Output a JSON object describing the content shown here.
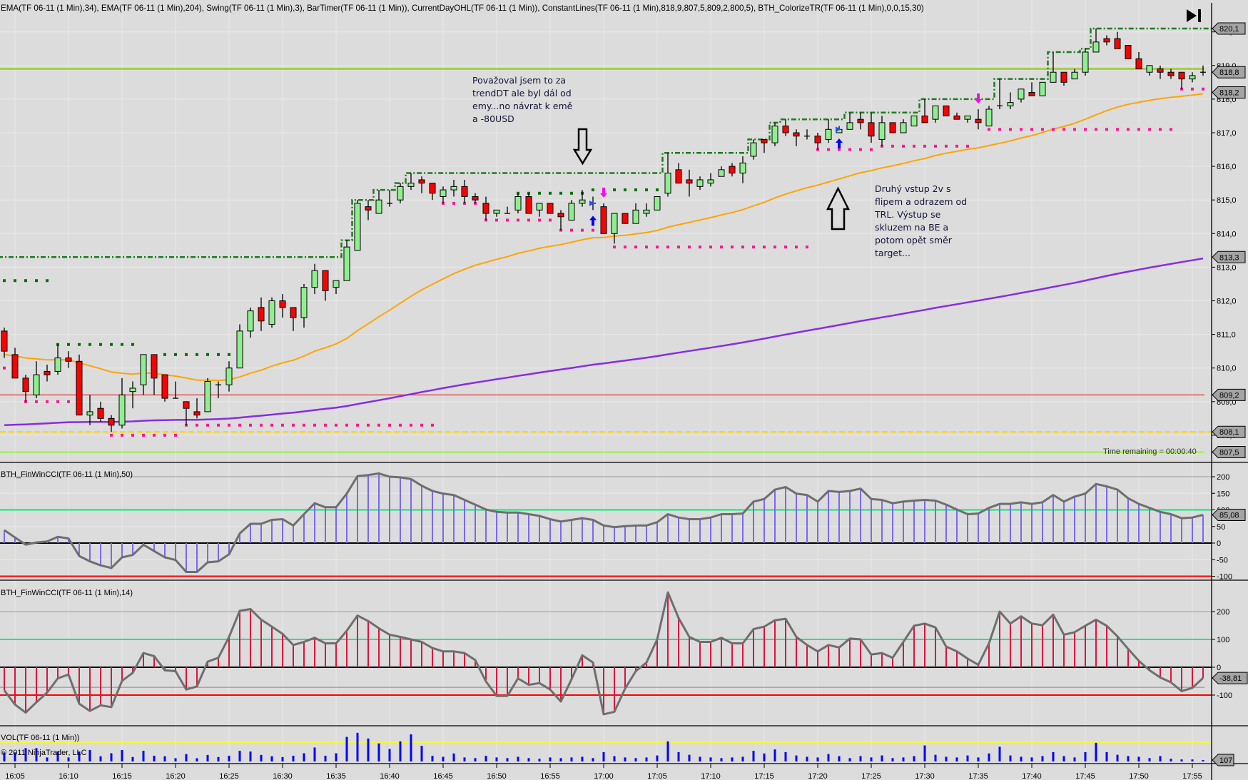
{
  "header": {
    "indicators": "EMA(TF 06-11 (1 Min),34), EMA(TF 06-11 (1 Min),204), Swing(TF 06-11 (1 Min),3), BarTimer(TF 06-11 (1 Min)), CurrentDayOHL(TF 06-11 (1 Min)), ConstantLines(TF 06-11 (1 Min),818,9,807,5,809,2,800,5), BTH_ColorizeTR(TF 06-11 (1 Min),0,0,15,30)",
    "scroll_end_icon": "skip-to-end-icon"
  },
  "panels": {
    "cci50_label": "BTH_FinWinCCI(TF 06-11 (1 Min),50)",
    "cci14_label": "BTH_FinWinCCI(TF 06-11 (1 Min),14)",
    "volume_label": "VOL(TF 06-11 (1 Min))",
    "copyright": "© 2011 NinjaTrader, LLC",
    "bar_timer": "Time remaining = 00:00:40"
  },
  "annotations": [
    {
      "text": "Považoval jsem to za\ntrendDT ale byl dál od\nemy...no návrat k emě\na -80USD",
      "arrow": "down"
    },
    {
      "text": "Druhý vstup 2v s\nflipem a odrazem od\nTRL. Výstup se\nskluzem na BE a\npotom opět směr\ntarget...",
      "arrow": "up"
    }
  ],
  "colors": {
    "background": "#dcdcdc",
    "up_candle": "#90ee90",
    "down_candle": "#ff0000",
    "ema34": "#ffa500",
    "ema204": "#8a2be2",
    "day_high": "#1e7b1e",
    "day_low": "#ffd700",
    "const_818_9": "#9acd32",
    "const_809_2": "#7cfc00",
    "const_807_5": "#e05050",
    "swing_high": "#007000",
    "swing_low": "#ff1493",
    "cci50_hist": "#7b68ee",
    "cci14_hist": "#dc143c",
    "cci_line": "#6e6e6e",
    "volume": "#0000ff"
  },
  "chart_data": {
    "type": "candlestick",
    "instrument": "TF 06-11",
    "interval": "1 Min",
    "first_bar_time": "16:04",
    "bar_interval_min": 1,
    "ohlc_fields": [
      "open",
      "high",
      "low",
      "close"
    ],
    "bars": [
      [
        811.1,
        811.2,
        810.3,
        810.5
      ],
      [
        810.4,
        810.6,
        809.7,
        809.7
      ],
      [
        809.7,
        809.8,
        809.0,
        809.3
      ],
      [
        809.2,
        810.2,
        809.1,
        809.8
      ],
      [
        809.9,
        810.1,
        809.6,
        809.8
      ],
      [
        809.9,
        810.7,
        809.8,
        810.3
      ],
      [
        810.3,
        810.5,
        810.0,
        810.2
      ],
      [
        810.2,
        810.4,
        808.6,
        808.6
      ],
      [
        808.6,
        809.2,
        808.3,
        808.7
      ],
      [
        808.8,
        809.0,
        808.4,
        808.5
      ],
      [
        808.5,
        808.6,
        808.1,
        808.3
      ],
      [
        808.3,
        809.7,
        808.2,
        809.2
      ],
      [
        809.3,
        809.6,
        808.8,
        809.4
      ],
      [
        809.5,
        810.4,
        809.2,
        810.4
      ],
      [
        810.4,
        810.4,
        809.2,
        809.7
      ],
      [
        809.8,
        809.8,
        809.0,
        809.1
      ],
      [
        809.1,
        809.6,
        809.1,
        809.1
      ],
      [
        809.0,
        809.0,
        808.3,
        808.8
      ],
      [
        808.7,
        809.1,
        808.5,
        808.6
      ],
      [
        808.7,
        809.7,
        808.7,
        809.6
      ],
      [
        809.5,
        809.6,
        809.1,
        809.5
      ],
      [
        809.5,
        810.2,
        809.3,
        810.0
      ],
      [
        810.0,
        811.3,
        810.0,
        811.1
      ],
      [
        811.1,
        811.8,
        810.9,
        811.7
      ],
      [
        811.8,
        812.1,
        811.1,
        811.4
      ],
      [
        811.3,
        812.1,
        811.2,
        812.0
      ],
      [
        812.0,
        812.2,
        811.5,
        811.8
      ],
      [
        811.8,
        811.8,
        811.1,
        811.5
      ],
      [
        811.5,
        812.5,
        811.2,
        812.4
      ],
      [
        812.4,
        813.1,
        812.2,
        812.9
      ],
      [
        812.9,
        812.9,
        812.0,
        812.3
      ],
      [
        812.4,
        812.6,
        812.2,
        812.6
      ],
      [
        812.6,
        813.8,
        812.6,
        813.6
      ],
      [
        813.5,
        815.0,
        813.5,
        814.9
      ],
      [
        814.8,
        815.0,
        814.4,
        814.7
      ],
      [
        814.6,
        815.3,
        814.6,
        815.0
      ],
      [
        814.9,
        815.3,
        814.8,
        814.9
      ],
      [
        815.0,
        815.5,
        814.9,
        815.4
      ],
      [
        815.4,
        815.8,
        815.3,
        815.5
      ],
      [
        815.6,
        815.7,
        815.2,
        815.5
      ],
      [
        815.5,
        815.5,
        815.0,
        815.2
      ],
      [
        815.1,
        815.4,
        814.9,
        815.3
      ],
      [
        815.3,
        815.6,
        815.1,
        815.4
      ],
      [
        815.4,
        815.6,
        814.9,
        815.1
      ],
      [
        815.1,
        815.2,
        814.9,
        815.0
      ],
      [
        814.9,
        815.1,
        814.4,
        814.6
      ],
      [
        814.6,
        814.7,
        814.5,
        814.7
      ],
      [
        814.6,
        814.8,
        814.6,
        814.6
      ],
      [
        814.7,
        815.2,
        814.6,
        815.1
      ],
      [
        815.1,
        815.2,
        814.6,
        814.6
      ],
      [
        814.7,
        814.9,
        814.5,
        814.9
      ],
      [
        814.9,
        814.9,
        814.6,
        814.6
      ],
      [
        814.6,
        814.7,
        814.1,
        814.5
      ],
      [
        814.4,
        815.0,
        814.4,
        814.9
      ],
      [
        814.9,
        815.3,
        814.8,
        815.0
      ],
      [
        814.9,
        815.1,
        814.7,
        814.9
      ],
      [
        814.8,
        814.9,
        814.0,
        814.0
      ],
      [
        814.0,
        814.6,
        813.7,
        814.6
      ],
      [
        814.6,
        814.6,
        814.3,
        814.3
      ],
      [
        814.3,
        814.9,
        814.3,
        814.7
      ],
      [
        814.6,
        814.9,
        814.5,
        814.7
      ],
      [
        814.7,
        815.1,
        814.7,
        815.1
      ],
      [
        815.2,
        816.4,
        815.1,
        815.8
      ],
      [
        815.9,
        816.1,
        815.5,
        815.5
      ],
      [
        815.6,
        815.9,
        815.1,
        815.5
      ],
      [
        815.4,
        815.7,
        815.3,
        815.6
      ],
      [
        815.5,
        815.8,
        815.4,
        815.6
      ],
      [
        815.7,
        816.0,
        815.7,
        815.9
      ],
      [
        816.0,
        816.1,
        815.7,
        815.8
      ],
      [
        815.8,
        816.3,
        815.5,
        816.1
      ],
      [
        816.3,
        816.8,
        816.2,
        816.7
      ],
      [
        816.8,
        816.8,
        816.4,
        816.7
      ],
      [
        816.7,
        817.3,
        816.6,
        817.2
      ],
      [
        817.2,
        817.4,
        816.9,
        817.0
      ],
      [
        817.0,
        817.1,
        816.6,
        816.9
      ],
      [
        816.9,
        817.1,
        816.8,
        816.9
      ],
      [
        816.9,
        817.0,
        816.5,
        816.7
      ],
      [
        816.8,
        817.4,
        816.7,
        817.1
      ],
      [
        817.0,
        817.2,
        817.0,
        817.1
      ],
      [
        817.1,
        817.6,
        817.1,
        817.3
      ],
      [
        817.4,
        817.6,
        817.1,
        817.3
      ],
      [
        817.3,
        817.6,
        816.7,
        816.9
      ],
      [
        816.8,
        817.5,
        816.6,
        817.3
      ],
      [
        817.3,
        817.3,
        817.0,
        817.0
      ],
      [
        817.0,
        817.4,
        817.0,
        817.3
      ],
      [
        817.2,
        817.5,
        817.2,
        817.5
      ],
      [
        817.5,
        818.0,
        817.3,
        817.3
      ],
      [
        817.4,
        817.8,
        817.3,
        817.8
      ],
      [
        817.8,
        817.8,
        817.5,
        817.5
      ],
      [
        817.5,
        817.6,
        817.4,
        817.4
      ],
      [
        817.4,
        817.5,
        817.3,
        817.5
      ],
      [
        817.4,
        817.7,
        817.1,
        817.3
      ],
      [
        817.2,
        817.8,
        817.2,
        817.7
      ],
      [
        817.8,
        818.6,
        817.7,
        817.8
      ],
      [
        817.8,
        818.2,
        817.7,
        817.9
      ],
      [
        818.0,
        818.3,
        817.9,
        818.3
      ],
      [
        818.2,
        818.5,
        818.1,
        818.1
      ],
      [
        818.1,
        818.5,
        818.1,
        818.5
      ],
      [
        818.5,
        819.4,
        818.5,
        818.8
      ],
      [
        818.8,
        818.8,
        818.4,
        818.5
      ],
      [
        818.6,
        818.9,
        818.6,
        818.8
      ],
      [
        818.8,
        819.5,
        818.7,
        819.4
      ],
      [
        819.4,
        820.1,
        819.4,
        819.7
      ],
      [
        819.8,
        819.9,
        819.6,
        819.7
      ],
      [
        819.8,
        820.0,
        819.5,
        819.5
      ],
      [
        819.6,
        819.6,
        819.2,
        819.2
      ],
      [
        819.2,
        819.4,
        818.9,
        818.9
      ],
      [
        818.8,
        819.0,
        818.7,
        819.0
      ],
      [
        818.9,
        819.0,
        818.6,
        818.8
      ],
      [
        818.8,
        818.9,
        818.6,
        818.7
      ],
      [
        818.8,
        818.8,
        818.3,
        818.6
      ],
      [
        818.6,
        818.8,
        818.5,
        818.7
      ],
      [
        818.8,
        819.0,
        818.7,
        818.8
      ]
    ],
    "ema": [
      {
        "name": "EMA 34",
        "period": 34,
        "seed": 810.4,
        "color_key": "ema34"
      },
      {
        "name": "EMA 204",
        "period": 204,
        "seed": 808.3,
        "color_key": "ema204"
      }
    ],
    "current_day": {
      "high": 820.1,
      "prior_high_at_start": 813.3,
      "low": 808.1
    },
    "constant_lines": [
      818.9,
      807.5,
      809.2,
      800.5
    ],
    "swings": [
      {
        "kind": "high",
        "price": 812.6,
        "from": "16:04",
        "to": "16:08"
      },
      {
        "kind": "high",
        "price": 810.7,
        "from": "16:09",
        "to": "16:16"
      },
      {
        "kind": "high",
        "price": 810.4,
        "from": "16:19",
        "to": "16:25"
      },
      {
        "kind": "high",
        "price": 815.2,
        "from": "16:52",
        "to": "16:58"
      },
      {
        "kind": "high",
        "price": 815.3,
        "from": "16:59",
        "to": "17:05"
      },
      {
        "kind": "low",
        "price": 810.0,
        "from": "16:04",
        "to": "16:04"
      },
      {
        "kind": "low",
        "price": 809.0,
        "from": "16:06",
        "to": "16:10"
      },
      {
        "kind": "low",
        "price": 808.0,
        "from": "16:14",
        "to": "16:20"
      },
      {
        "kind": "low",
        "price": 808.3,
        "from": "16:21",
        "to": "16:44"
      },
      {
        "kind": "low",
        "price": 814.9,
        "from": "16:45",
        "to": "16:48"
      },
      {
        "kind": "low",
        "price": 814.4,
        "from": "16:49",
        "to": "16:55"
      },
      {
        "kind": "low",
        "price": 814.1,
        "from": "16:56",
        "to": "16:59"
      },
      {
        "kind": "low",
        "price": 813.6,
        "from": "17:01",
        "to": "17:19"
      },
      {
        "kind": "low",
        "price": 816.5,
        "from": "17:20",
        "to": "17:25"
      },
      {
        "kind": "low",
        "price": 816.6,
        "from": "17:26",
        "to": "17:34"
      },
      {
        "kind": "low",
        "price": 817.1,
        "from": "17:36",
        "to": "17:53"
      },
      {
        "kind": "low",
        "price": 818.3,
        "from": "17:54",
        "to": "17:56"
      }
    ],
    "signals": [
      {
        "type": "long",
        "time": "16:59"
      },
      {
        "type": "short",
        "time": "17:00"
      },
      {
        "type": "long",
        "time": "17:22"
      },
      {
        "type": "short",
        "time": "17:35"
      }
    ],
    "price_axis": {
      "ticks": [
        "808,0",
        "809,0",
        "810,0",
        "811,0",
        "812,0",
        "813,0",
        "814,0",
        "815,0",
        "816,0",
        "817,0",
        "818,0",
        "819,0",
        "820,0"
      ]
    },
    "price_flags": [
      {
        "text": "820,1",
        "value": 820.1
      },
      {
        "text": "818,8",
        "value": 818.8
      },
      {
        "text": "818,2",
        "value": 818.2
      },
      {
        "text": "813,3",
        "value": 813.3
      },
      {
        "text": "809,2",
        "value": 809.2
      },
      {
        "text": "808,1",
        "value": 808.1
      },
      {
        "text": "807,5",
        "value": 807.5
      }
    ],
    "time_labels": [
      "16:05",
      "16:10",
      "16:15",
      "16:20",
      "16:25",
      "16:30",
      "16:35",
      "16:40",
      "16:45",
      "16:50",
      "16:55",
      "17:00",
      "17:05",
      "17:10",
      "17:15",
      "17:20",
      "17:25",
      "17:30",
      "17:35",
      "17:40",
      "17:45",
      "17:50",
      "17:55"
    ],
    "cci50": {
      "ticks": [
        "200",
        "150",
        "100",
        "50",
        "0",
        "-50",
        "-100"
      ],
      "levels": [
        200,
        100,
        0,
        -100
      ],
      "flag": "85,08",
      "values": [
        39,
        17,
        -5,
        2,
        5,
        19,
        14,
        -39,
        -55,
        -67,
        -75,
        -43,
        -36,
        -5,
        -24,
        -43,
        -51,
        -87,
        -87,
        -58,
        -55,
        -34,
        29,
        58,
        58,
        70,
        72,
        53,
        87,
        120,
        108,
        108,
        149,
        202,
        205,
        210,
        200,
        198,
        193,
        173,
        157,
        149,
        145,
        130,
        116,
        101,
        94,
        92,
        92,
        87,
        82,
        72,
        65,
        70,
        75,
        70,
        53,
        48,
        51,
        53,
        53,
        63,
        87,
        77,
        72,
        72,
        77,
        87,
        87,
        89,
        125,
        133,
        161,
        169,
        149,
        145,
        125,
        157,
        154,
        157,
        164,
        133,
        130,
        120,
        125,
        128,
        130,
        128,
        116,
        101,
        87,
        89,
        106,
        118,
        118,
        123,
        118,
        123,
        145,
        125,
        140,
        149,
        178,
        171,
        161,
        135,
        118,
        106,
        94,
        87,
        75,
        77,
        85.08
      ]
    },
    "cci14": {
      "ticks": [
        "200",
        "100",
        "0",
        "-100"
      ],
      "levels": [
        200,
        100,
        0,
        -100
      ],
      "flag": "-38,81",
      "values": [
        -83,
        -134,
        -163,
        -126,
        -91,
        -40,
        -26,
        -131,
        -157,
        -137,
        -143,
        -49,
        -20,
        51,
        40,
        -11,
        -14,
        -80,
        -69,
        20,
        34,
        109,
        203,
        209,
        171,
        146,
        120,
        80,
        91,
        106,
        86,
        86,
        131,
        186,
        166,
        140,
        117,
        109,
        100,
        91,
        69,
        57,
        57,
        51,
        26,
        -51,
        -103,
        -103,
        -40,
        -63,
        -57,
        -80,
        -123,
        -43,
        43,
        17,
        -169,
        -160,
        -77,
        -14,
        17,
        100,
        269,
        177,
        109,
        91,
        91,
        106,
        86,
        86,
        137,
        146,
        169,
        174,
        109,
        80,
        57,
        80,
        71,
        103,
        100,
        46,
        51,
        34,
        91,
        149,
        157,
        143,
        74,
        57,
        31,
        9,
        86,
        200,
        157,
        183,
        157,
        151,
        189,
        117,
        126,
        149,
        171,
        149,
        111,
        66,
        23,
        -11,
        -37,
        -54,
        -86,
        -74,
        -38.81
      ]
    },
    "volume": {
      "flag": "107",
      "values": [
        675,
        675,
        1000,
        1000,
        300,
        740,
        300,
        740,
        860,
        390,
        615,
        860,
        330,
        800,
        430,
        390,
        245,
        550,
        245,
        490,
        330,
        430,
        800,
        740,
        490,
        390,
        330,
        430,
        615,
        1045,
        430,
        615,
        1840,
        2150,
        1720,
        1350,
        940,
        1500,
        2030,
        1170,
        420,
        350,
        600,
        300,
        250,
        420,
        300,
        250,
        350,
        250,
        200,
        300,
        250,
        300,
        350,
        250,
        700,
        400,
        300,
        250,
        300,
        450,
        1500,
        700,
        500,
        350,
        300,
        250,
        300,
        350,
        800,
        600,
        900,
        700,
        450,
        350,
        300,
        550,
        400,
        250,
        400,
        300,
        450,
        250,
        300,
        400,
        1200,
        500,
        350,
        300,
        450,
        300,
        600,
        1100,
        450,
        350,
        300,
        400,
        700,
        400,
        300,
        700,
        1400,
        700,
        500,
        400,
        350,
        250,
        400,
        200,
        150,
        150,
        107
      ]
    }
  }
}
